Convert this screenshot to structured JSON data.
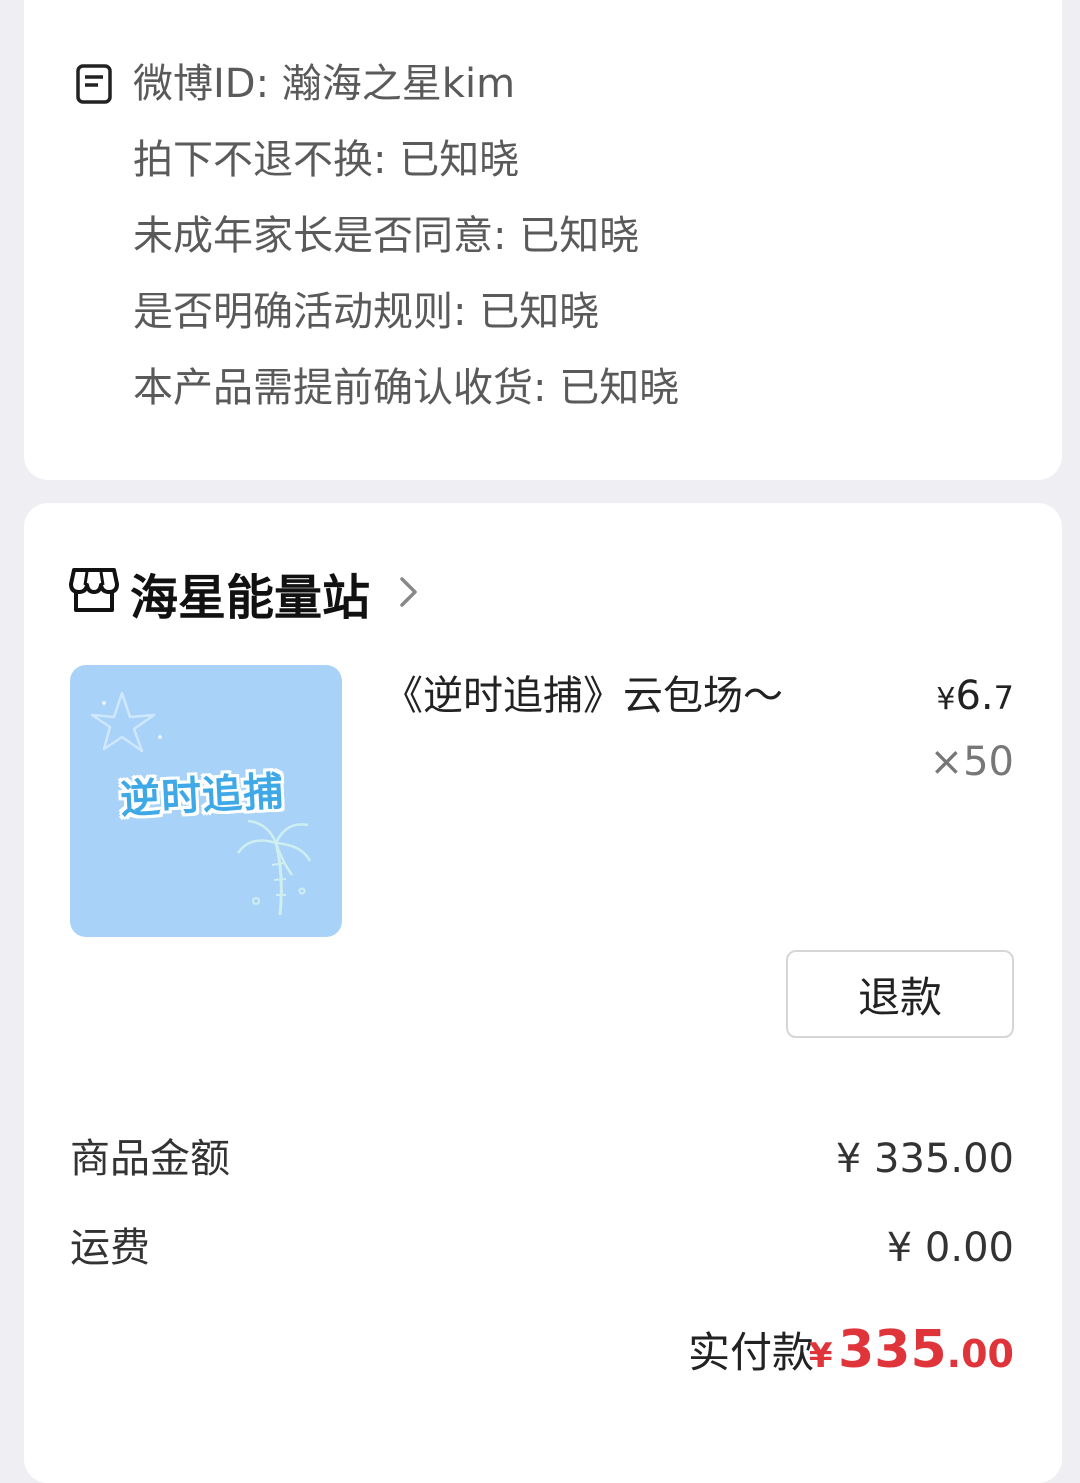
{
  "notes": [
    "微博ID: 瀚海之星kim",
    "拍下不退不换: 已知晓",
    "未成年家长是否同意: 已知晓",
    "是否明确活动规则: 已知晓",
    "本产品需提前确认收货: 已知晓"
  ],
  "shop": {
    "name": "海星能量站"
  },
  "product": {
    "thumb_text": "逆时追捕",
    "title": "《逆时追捕》云包场～",
    "price_currency": "¥",
    "price_int": "6.",
    "price_dec": "7",
    "quantity": "×50",
    "refund_label": "退款"
  },
  "summary": {
    "goods_label": "商品金额",
    "goods_value": "¥ 335.00",
    "shipping_label": "运费",
    "shipping_value": "¥ 0.00",
    "paid_label": "实付款",
    "paid_currency": "¥",
    "paid_int": "335",
    "paid_dec": ".00"
  },
  "colors": {
    "accent_red": "#e0343b",
    "thumb_bg": "#a8d2f7",
    "page_bg": "#efeff3"
  }
}
